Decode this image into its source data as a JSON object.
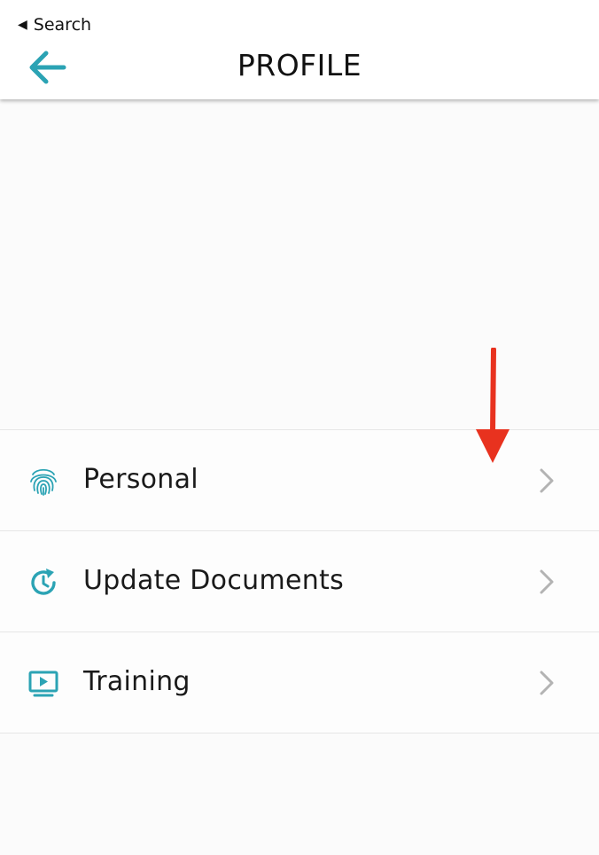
{
  "status_bar": {
    "back_glyph": "◀",
    "back_label": "Search"
  },
  "header": {
    "back_icon": "arrow-left-icon",
    "title": "PROFILE"
  },
  "menu": {
    "items": [
      {
        "label": "Personal",
        "icon": "fingerprint-icon"
      },
      {
        "label": "Update Documents",
        "icon": "clock-refresh-icon"
      },
      {
        "label": "Training",
        "icon": "monitor-play-icon"
      }
    ]
  },
  "colors": {
    "accent": "#2ba3b4",
    "chevron": "#b3b3b3",
    "annotation": "#e8321f",
    "background": "#fbfbfb",
    "divider": "#e6e6e6"
  }
}
